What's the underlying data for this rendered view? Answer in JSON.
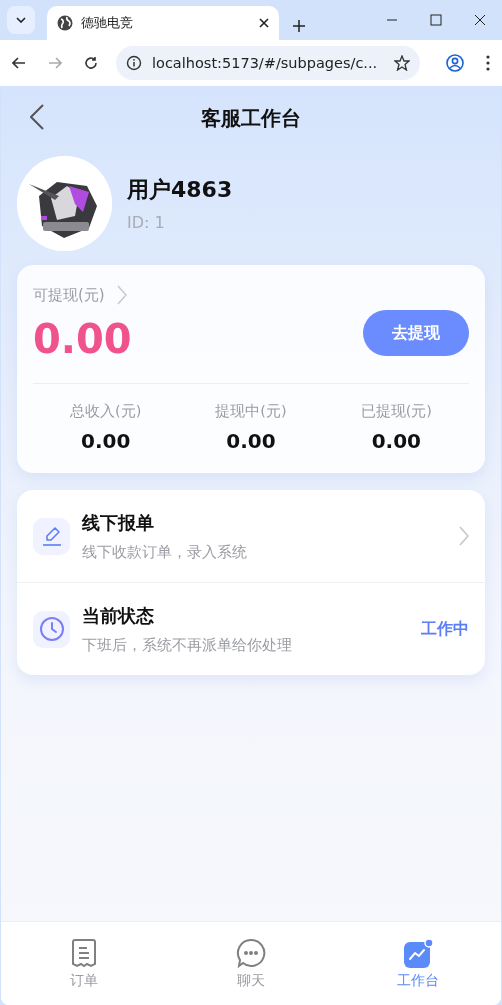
{
  "browser": {
    "tab_title": "德驰电竞",
    "url": "localhost:5173/#/subpages/c..."
  },
  "header": {
    "title": "客服工作台"
  },
  "profile": {
    "name": "用户4863",
    "id": "ID: 1"
  },
  "wallet": {
    "label": "可提现(元)",
    "amount": "0.00",
    "button": "去提现",
    "stats": [
      {
        "label": "总收入(元)",
        "value": "0.00"
      },
      {
        "label": "提现中(元)",
        "value": "0.00"
      },
      {
        "label": "已提现(元)",
        "value": "0.00"
      }
    ]
  },
  "menu": [
    {
      "kind": "link",
      "title": "线下报单",
      "subtitle": "线下收款订单，录入系统"
    },
    {
      "kind": "status",
      "title": "当前状态",
      "subtitle": "下班后，系统不再派单给你处理",
      "status": "工作中"
    }
  ],
  "tab_bar": [
    {
      "label": "订单",
      "selected": false
    },
    {
      "label": "聊天",
      "selected": false
    },
    {
      "label": "工作台",
      "selected": true
    }
  ]
}
